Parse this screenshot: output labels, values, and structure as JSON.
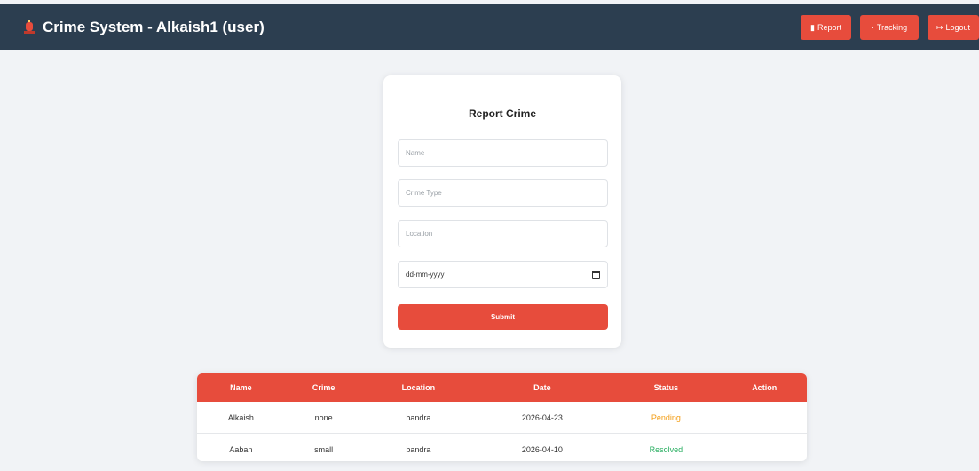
{
  "navbar": {
    "title": "Crime System - Alkaish1 (user)",
    "icon": "siren-icon",
    "buttons": [
      {
        "label": "Report",
        "icon": "document-icon"
      },
      {
        "label": "Tracking",
        "icon": "pin-icon"
      },
      {
        "label": "Logout",
        "icon": "exit-icon"
      }
    ]
  },
  "form": {
    "title": "Report Crime",
    "name_placeholder": "Name",
    "crime_type_placeholder": "Crime Type",
    "location_placeholder": "Location",
    "date_placeholder": "dd-mm-yyyy",
    "submit_label": "Submit"
  },
  "table": {
    "headers": [
      "Name",
      "Crime",
      "Location",
      "Date",
      "Status",
      "Action"
    ],
    "rows": [
      {
        "name": "Alkaish",
        "crime": "none",
        "location": "bandra",
        "date": "2026-04-23",
        "status": "Pending",
        "action": ""
      },
      {
        "name": "Aaban",
        "crime": "small",
        "location": "bandra",
        "date": "2026-04-10",
        "status": "Resolved",
        "action": ""
      }
    ]
  },
  "colors": {
    "navbar": "#2c3e50",
    "accent": "#e74c3c",
    "pending": "#f39c12",
    "resolved": "#27ae60"
  }
}
